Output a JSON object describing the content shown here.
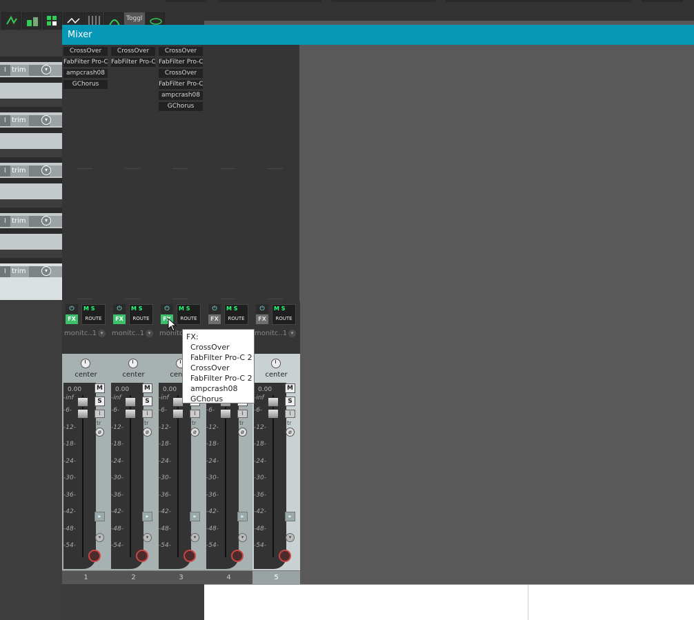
{
  "toolbar": {
    "toggle_label": "Toggl"
  },
  "tcp": {
    "tracks": [
      {
        "trim": "trim"
      },
      {
        "trim": "trim"
      },
      {
        "trim": "trim"
      },
      {
        "trim": "trim"
      },
      {
        "trim": "trim"
      }
    ]
  },
  "mixer": {
    "title": "Mixer",
    "fx_label": "FX",
    "route_label": "ROUTE",
    "ms_label": "M S",
    "tr_label": "tr",
    "monitor_label": "monitc..1",
    "pan_label": "center",
    "volume": "0.00",
    "m_label": "M",
    "s_label": "S",
    "scale": [
      "-inf",
      "-6-",
      "-12-",
      "-18-",
      "-24-",
      "-30-",
      "-36-",
      "-42-",
      "-48-",
      "-54-"
    ],
    "strips": [
      {
        "number": "1",
        "fx": [
          "CrossOver",
          "FabFilter Pro-C",
          "ampcrash08",
          "GChorus"
        ],
        "fx_active": true
      },
      {
        "number": "2",
        "fx": [
          "CrossOver",
          "FabFilter Pro-C"
        ],
        "fx_active": true
      },
      {
        "number": "3",
        "fx": [
          "CrossOver",
          "FabFilter Pro-C",
          "CrossOver",
          "FabFilter Pro-C",
          "ampcrash08",
          "GChorus"
        ],
        "fx_active": true
      },
      {
        "number": "4",
        "fx": [],
        "fx_active": false
      },
      {
        "number": "5",
        "fx": [],
        "fx_active": false
      }
    ]
  },
  "tooltip": {
    "header": "FX:",
    "items": [
      "CrossOver",
      "FabFilter Pro-C 2",
      "CrossOver",
      "FabFilter Pro-C 2",
      "ampcrash08",
      "GChorus"
    ]
  },
  "colors": {
    "titlebar": "#0797b7",
    "fx_on": "#3dbf6c"
  }
}
